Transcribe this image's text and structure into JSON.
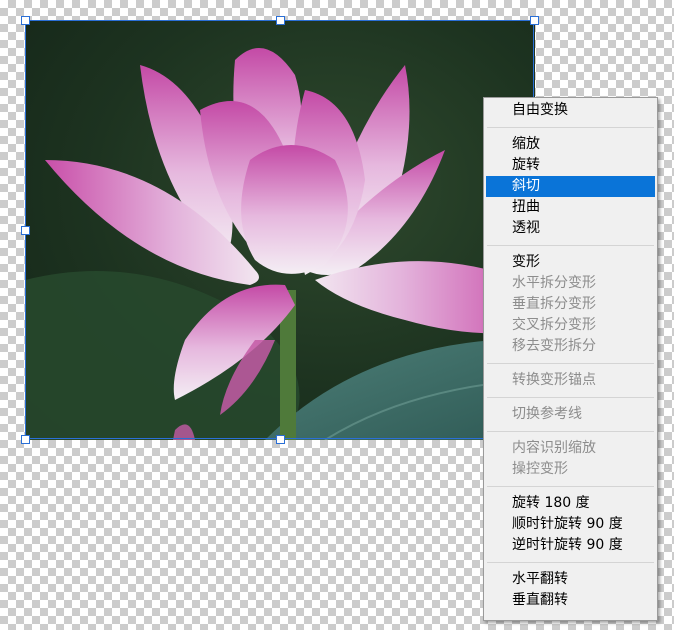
{
  "canvas": {
    "image_description_name": "lotus-photo",
    "selection_color": "#2a6fd6"
  },
  "context_menu": {
    "highlight_color": "#0a74d8",
    "groups": [
      [
        {
          "label": "自由变换",
          "enabled": true
        }
      ],
      [
        {
          "label": "缩放",
          "enabled": true
        },
        {
          "label": "旋转",
          "enabled": true
        },
        {
          "label": "斜切",
          "enabled": true,
          "selected": true
        },
        {
          "label": "扭曲",
          "enabled": true
        },
        {
          "label": "透视",
          "enabled": true
        }
      ],
      [
        {
          "label": "变形",
          "enabled": true
        },
        {
          "label": "水平拆分变形",
          "enabled": false
        },
        {
          "label": "垂直拆分变形",
          "enabled": false
        },
        {
          "label": "交叉拆分变形",
          "enabled": false
        },
        {
          "label": "移去变形拆分",
          "enabled": false
        }
      ],
      [
        {
          "label": "转换变形锚点",
          "enabled": false
        }
      ],
      [
        {
          "label": "切换参考线",
          "enabled": false
        }
      ],
      [
        {
          "label": "内容识别缩放",
          "enabled": false
        },
        {
          "label": "操控变形",
          "enabled": false
        }
      ],
      [
        {
          "label": "旋转 180 度",
          "enabled": true
        },
        {
          "label": "顺时针旋转 90 度",
          "enabled": true
        },
        {
          "label": "逆时针旋转 90 度",
          "enabled": true
        }
      ],
      [
        {
          "label": "水平翻转",
          "enabled": true
        },
        {
          "label": "垂直翻转",
          "enabled": true
        }
      ]
    ]
  }
}
